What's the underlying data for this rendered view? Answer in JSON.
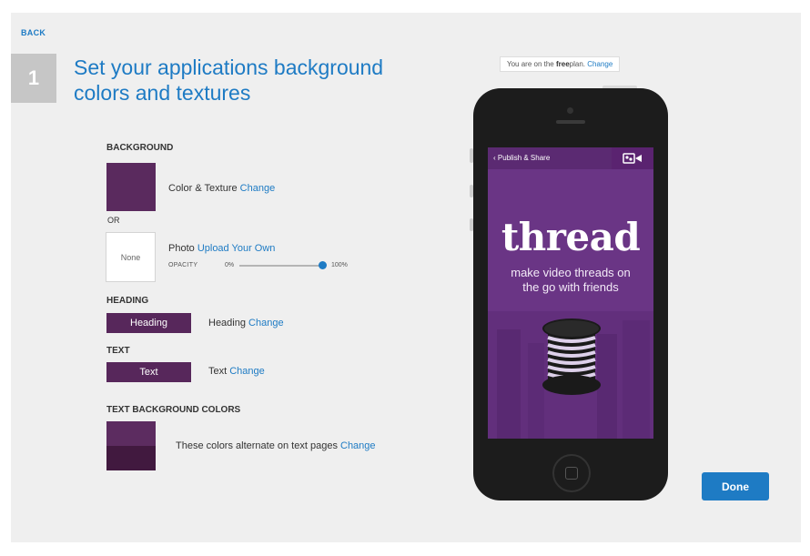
{
  "nav": {
    "back_label": "BACK"
  },
  "step": {
    "number": "1",
    "title": "Set your applications background colors and textures"
  },
  "plan_notice": {
    "prefix": "You are on the ",
    "plan": "free",
    "suffix": " plan. ",
    "change_label": "Change"
  },
  "background": {
    "section_label": "BACKGROUND",
    "color_texture_label": "Color & Texture ",
    "color_texture_change": "Change",
    "or_label": "OR",
    "photo_placeholder": "None",
    "photo_label": "Photo ",
    "photo_upload": "Upload Your Own",
    "opacity_label": "OPACITY",
    "opacity_min": "0%",
    "opacity_max": "100%",
    "opacity_value": 1.0
  },
  "heading": {
    "section_label": "HEADING",
    "sample": "Heading",
    "label": "Heading ",
    "change": "Change"
  },
  "text": {
    "section_label": "TEXT",
    "sample": "Text",
    "label": "Text ",
    "change": "Change"
  },
  "text_bg": {
    "section_label": "TEXT BACKGROUND COLORS",
    "label": "These colors alternate on text pages ",
    "change": "Change"
  },
  "preview": {
    "back_label": "Publish & Share",
    "app_name": "thread",
    "tagline_line1": "make video threads on",
    "tagline_line2": "the go with friends"
  },
  "actions": {
    "done_label": "Done"
  },
  "colors": {
    "accent": "#1e7bc4",
    "swatch_purple": "#5a2a5e",
    "text_bg_top": "#5c2c60",
    "text_bg_bottom": "#41193f"
  },
  "icons": [
    "chevron-left-icon",
    "video-camera-icon",
    "spool-icon"
  ]
}
